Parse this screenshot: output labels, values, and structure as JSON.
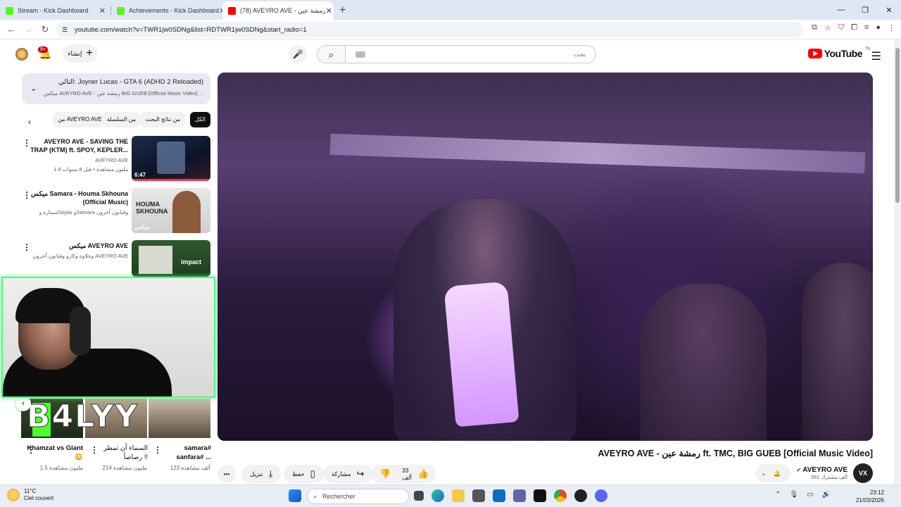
{
  "browser": {
    "tabs": [
      {
        "title": "Stream - Kick Dashboard",
        "color": "#53fc18"
      },
      {
        "title": "Achievements - Kick Dashboard",
        "color": "#53fc18"
      },
      {
        "title": "(78) AVEYRO AVE - رمشة عين",
        "color": "#ff0000"
      }
    ],
    "url": "youtube.com/watch?v=TWR1jw0SDNg&list=RDTWR1jw0SDNg&start_radio=1"
  },
  "youtube": {
    "logo_text": "YouTube",
    "logo_region": "TN",
    "search_placeholder": "بحث",
    "create_label": "إنشاء",
    "notifications_badge": "9+"
  },
  "up_next": {
    "label": "التالي: Joyner Lucas - GTA 6 (ADHD 2 Reloaded)",
    "subtitle": "ميكس AVEYRO AVE - رمشة عين BIG GUEB [Official Music Video] ..."
  },
  "chips": [
    "الكل",
    "من نتائج البحث",
    "من السلسلة",
    "من AVEYRO AVE"
  ],
  "related": [
    {
      "title": "AVEYRO AVE - SAVING THE TRAP (KTM) ft. SPOY, KEPLER...",
      "channel": "AVEYRO AVE",
      "meta": "1.9 مليون مشاهدة • قبل 8 سنوات",
      "duration": "6:47"
    },
    {
      "title": "ميكس Samara - Houma Skhouna (Official Music)",
      "channel": "",
      "meta": "سمارة وSayax وSamara وفنانون آخرون",
      "duration": "ميكس"
    },
    {
      "title": "ميكس AVEYRO AVE",
      "channel": "",
      "meta": "وحلاوة وكازو وفنانون آخرون AVEYRO AVE",
      "duration": ""
    }
  ],
  "shorts": [
    {
      "title": "Khamzat vs Giant 😳",
      "views": "1.5 مليون مشاهدة"
    },
    {
      "title": "السماء أن تمطر رصاصاً !!",
      "views": "214 مليون مشاهدة"
    },
    {
      "title": "samara# sanfara# ...",
      "views": "123 ألف مشاهدة"
    }
  ],
  "overlay_text": "B4LYY",
  "video": {
    "title": "AVEYRO AVE - رمشة عين ft. TMC, BIG GUEB [Official Music Video]",
    "channel": "AVEYRO AVE",
    "subscribers": "391 ألف مشترك",
    "channel_avatar": "VX",
    "likes": "33 ألف",
    "share_label": "مشاركة",
    "save_label": "حفظ",
    "download_label": "تنزيل"
  },
  "taskbar": {
    "temperature": "11°C",
    "weather": "Ciel couvert",
    "search_label": "Rechercher",
    "time": "23:12",
    "date": "21/03/2026"
  }
}
